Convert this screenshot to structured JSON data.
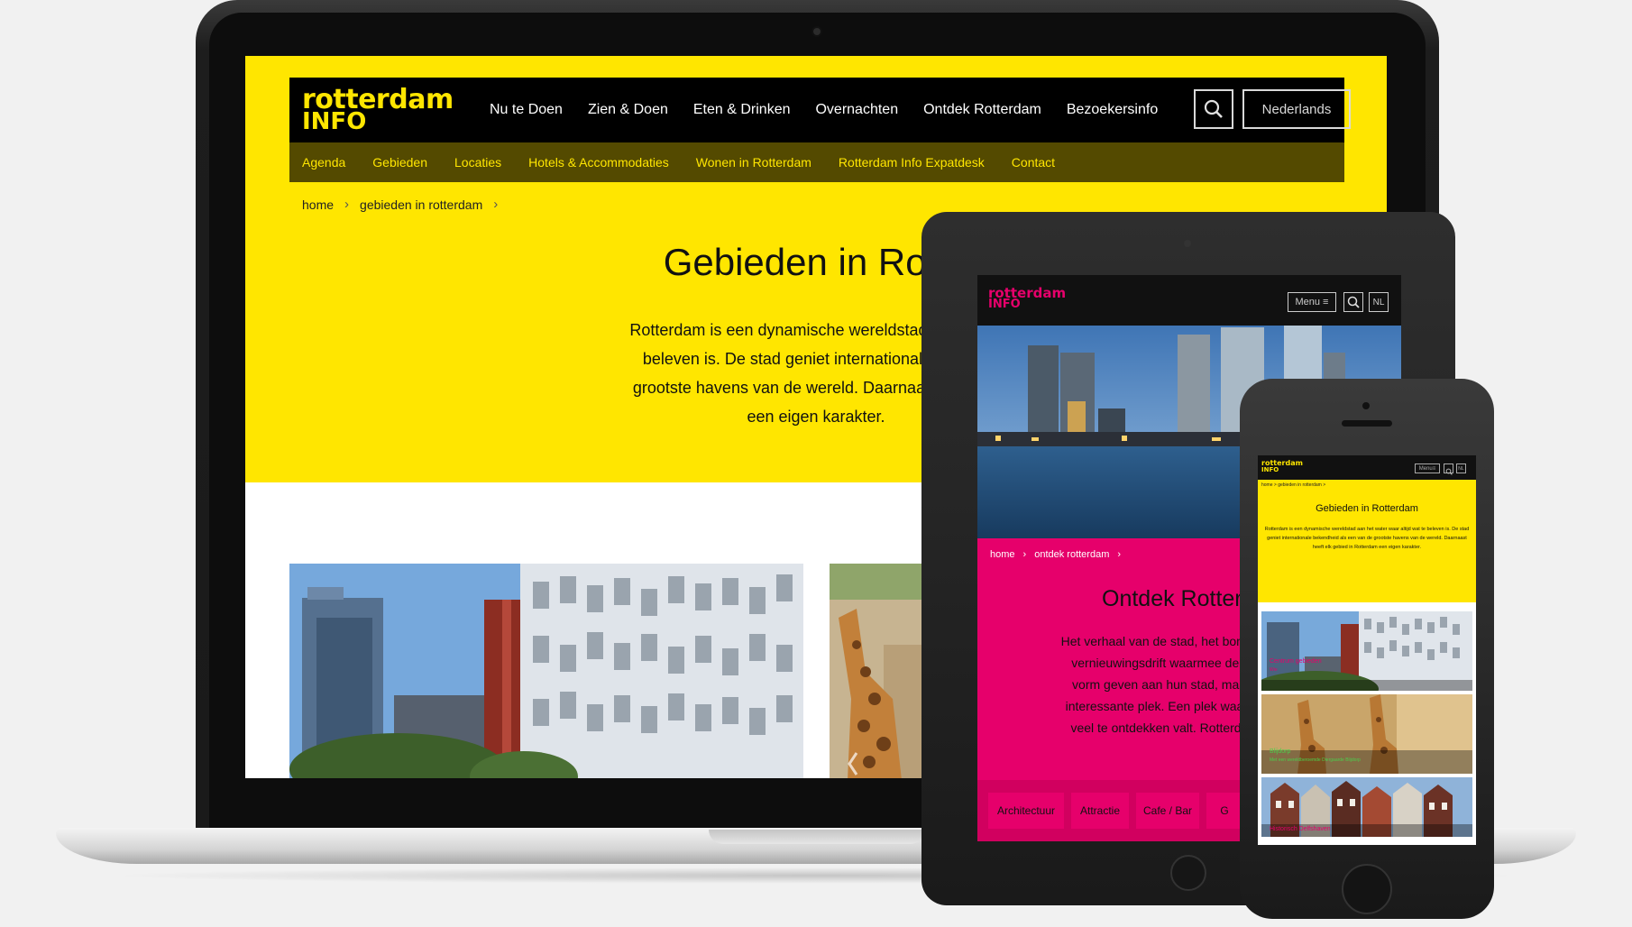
{
  "laptop": {
    "logo_line1": "rotterdam",
    "logo_line2": "INFO",
    "nav": [
      "Nu te Doen",
      "Zien & Doen",
      "Eten & Drinken",
      "Overnachten",
      "Ontdek Rotterdam",
      "Bezoekersinfo"
    ],
    "language": "Nederlands",
    "subnav": [
      "Agenda",
      "Gebieden",
      "Locaties",
      "Hotels & Accommodaties",
      "Wonen in Rotterdam",
      "Rotterdam Info Expatdesk",
      "Contact"
    ],
    "breadcrumb": [
      "home",
      "gebieden in rotterdam"
    ],
    "title": "Gebieden in Rotte",
    "intro": [
      "Rotterdam is een dynamische wereldstad aan het w",
      "beleven is. De stad geniet internationale bekend",
      "grootste havens van de wereld. Daarnaast heeft ell",
      "een eigen karakter."
    ]
  },
  "tablet": {
    "logo_line1": "rotterdam",
    "logo_line2": "INFO",
    "menu": "Menu",
    "language": "NL",
    "breadcrumb": [
      "home",
      "ontdek rotterdam"
    ],
    "title": "Ontdek Rotterd",
    "text": [
      "Het verhaal van de stad, het bombardement o",
      "vernieuwingsdrift waarmee de inwoners to",
      "vorm geven aan hun stad, maakt van Rott",
      "interessante plek. Een plek waar alles lijkt te",
      "veel te ontdekken valt. Rotterdam, een"
    ],
    "text_em": "mu",
    "tags": [
      "Architectuur",
      "Attractie",
      "Cafe / Bar",
      "G"
    ]
  },
  "phone": {
    "logo_line1": "rotterdam",
    "logo_line2": "INFO",
    "menu": "Menu",
    "language": "NL",
    "breadcrumb": "home  >  gebieden in rotterdam  >",
    "title": "Gebieden in Rotterdam",
    "text": "Rotterdam is een dynamische wereldstad aan het water waar altijd wat te beleven is. De stad geniet internationale bekendheid als een van de grootste havens van de wereld. Daarnaast heeft elk gebied in Rotterdam een eigen karakter.",
    "cards": [
      {
        "caption": "Centrum gebieden",
        "sub": "Wie"
      },
      {
        "caption": "Blijdorp",
        "sub": "Met een wereldberoemde Diergaarde Blijdorp"
      },
      {
        "caption": "Historisch Delfshaven",
        "sub": ""
      }
    ]
  },
  "colors": {
    "brand_yellow": "#ffe600",
    "brand_magenta": "#e6006b",
    "subnav_olive": "#544a00"
  }
}
